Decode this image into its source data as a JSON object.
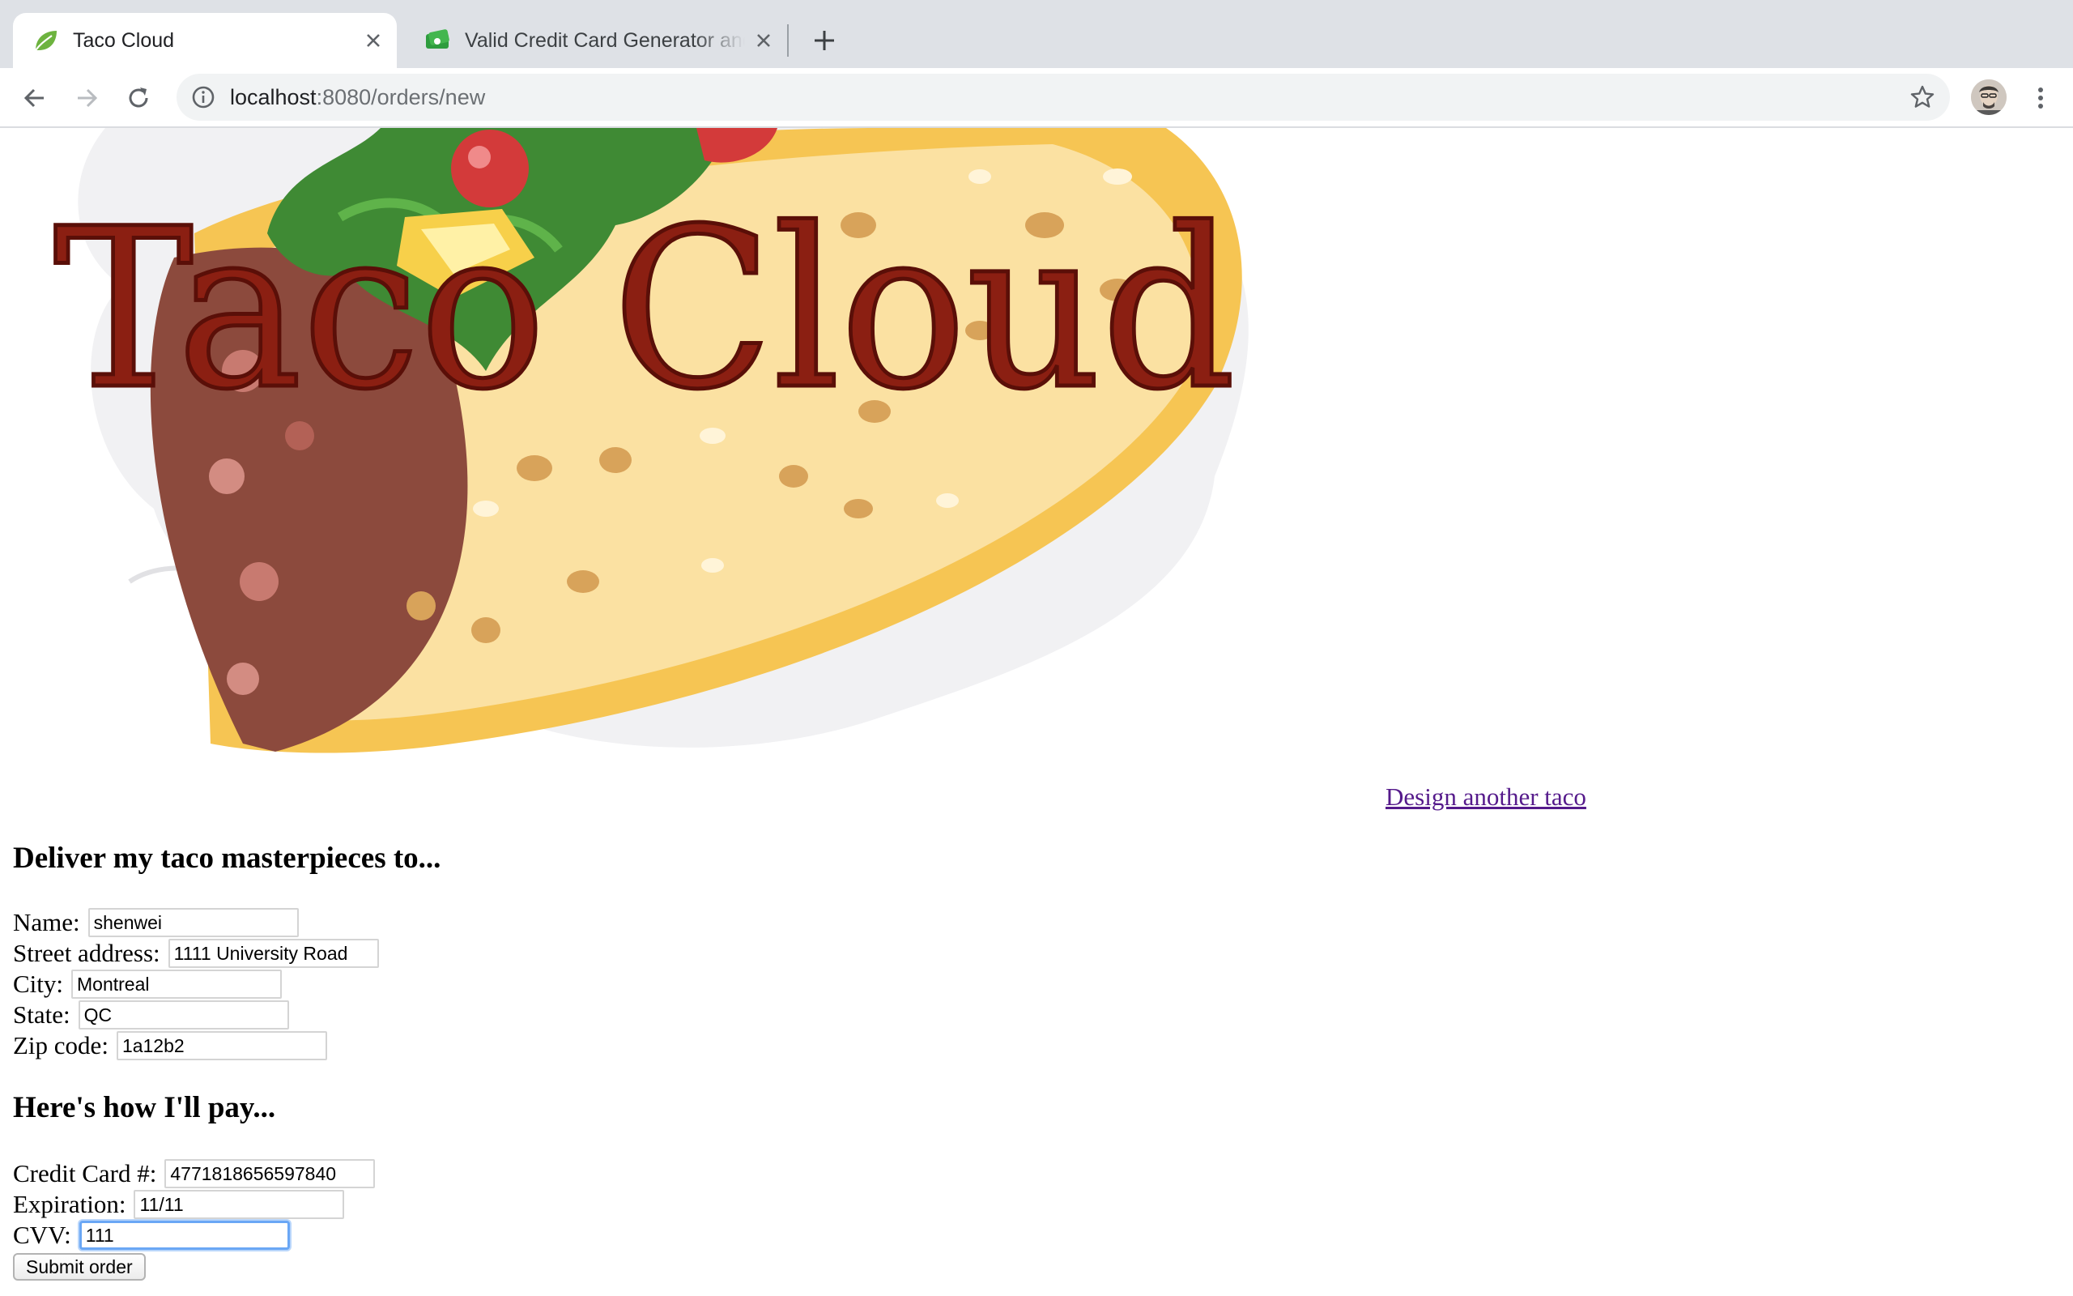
{
  "browser": {
    "tabs": [
      {
        "title": "Taco Cloud",
        "active": true,
        "favicon": "spring-leaf-icon"
      },
      {
        "title": "Valid Credit Card Generator and",
        "active": false,
        "favicon": "money-card-icon"
      }
    ],
    "url_host": "localhost",
    "url_path": ":8080/orders/new"
  },
  "page": {
    "logo_text": "Taco Cloud",
    "design_link": "Design another taco",
    "deliver_heading": "Deliver my taco masterpieces to...",
    "delivery": {
      "name_label": "Name:",
      "name_value": "shenwei",
      "street_label": "Street address:",
      "street_value": "1111 University Road",
      "city_label": "City:",
      "city_value": "Montreal",
      "state_label": "State:",
      "state_value": "QC",
      "zip_label": "Zip code:",
      "zip_value": "1a12b2"
    },
    "pay_heading": "Here's how I'll pay...",
    "payment": {
      "cc_label": "Credit Card #:",
      "cc_value": "4771818656597840",
      "exp_label": "Expiration:",
      "exp_value": "11/11",
      "cvv_label": "CVV:",
      "cvv_value": "111"
    },
    "submit_label": "Submit order"
  },
  "colors": {
    "link_visited": "#551a8b",
    "focus_ring": "#6aa7f5",
    "logo_text": "#8b1f12"
  }
}
